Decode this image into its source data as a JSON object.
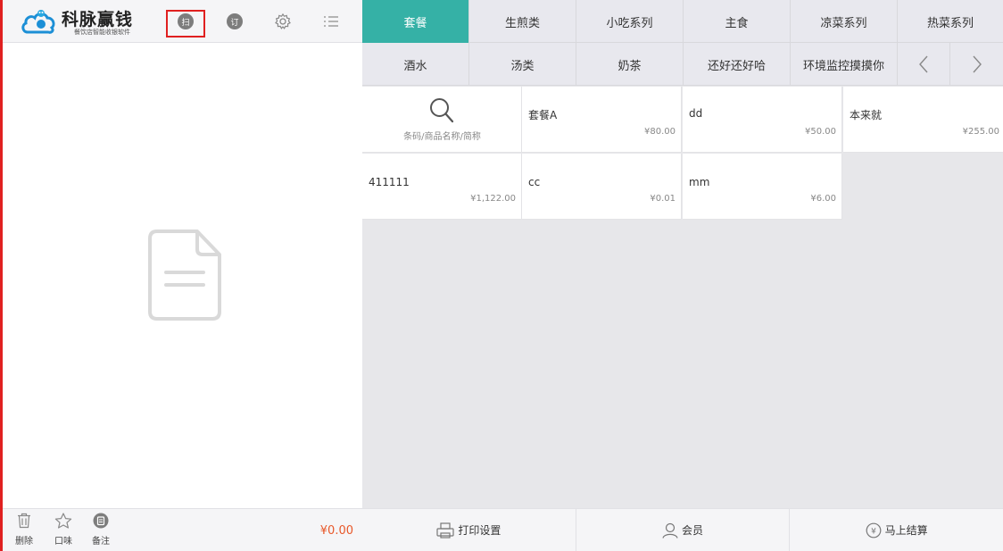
{
  "brand": {
    "name": "科脉赢钱",
    "slogan": "餐饮店智能收银软件"
  },
  "toolbar": {
    "scan_label": "扫",
    "order_label": "订"
  },
  "categories_row1": [
    {
      "label": "套餐",
      "active": true
    },
    {
      "label": "生煎类"
    },
    {
      "label": "小吃系列"
    },
    {
      "label": "主食"
    },
    {
      "label": "凉菜系列"
    },
    {
      "label": "热菜系列"
    }
  ],
  "categories_row2": [
    {
      "label": "酒水"
    },
    {
      "label": "汤类"
    },
    {
      "label": "奶茶"
    },
    {
      "label": "还好还好哈"
    },
    {
      "label": "环境监控摸摸你"
    }
  ],
  "search": {
    "placeholder": "条码/商品名称/简称"
  },
  "products": [
    {
      "name": "套餐A",
      "price": "¥80.00"
    },
    {
      "name": "dd",
      "price": "¥50.00"
    },
    {
      "name": "本来就",
      "price": "¥255.00"
    },
    {
      "name": "411111",
      "price": "¥1,122.00"
    },
    {
      "name": "cc",
      "price": "¥0.01"
    },
    {
      "name": "mm",
      "price": "¥6.00"
    }
  ],
  "order_footer": {
    "delete_label": "删除",
    "taste_label": "口味",
    "note_label": "备注",
    "total": "¥0.00"
  },
  "actions": {
    "print_label": "打印设置",
    "member_label": "会员",
    "checkout_label": "马上结算"
  },
  "colors": {
    "accent": "#35b1a6",
    "total": "#e8582a",
    "highlight": "#e02020"
  }
}
